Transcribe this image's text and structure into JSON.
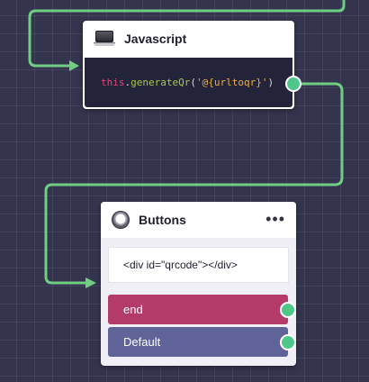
{
  "nodes": {
    "javascript": {
      "title": "Javascript",
      "icon": "laptop-icon",
      "code": {
        "keyword": "this",
        "dot": ".",
        "method": "generateQr",
        "open": "(",
        "string": "'@{urltoqr}'",
        "close": ")"
      }
    },
    "buttons": {
      "title": "Buttons",
      "icon": "radio-icon",
      "more": "•••",
      "html_content": "<div id=\"qrcode\"></div>",
      "options": [
        {
          "label": "end",
          "color": "#b43a6a"
        },
        {
          "label": "Default",
          "color": "#5f6398"
        }
      ]
    }
  },
  "colors": {
    "canvas": "#34344f",
    "connector": "#6fce84",
    "port": "#50c78a"
  }
}
